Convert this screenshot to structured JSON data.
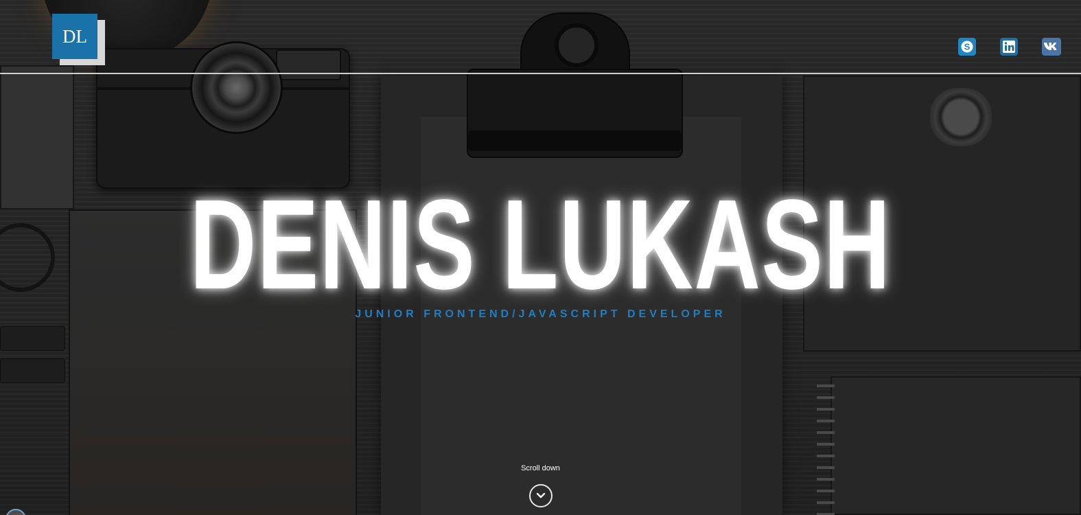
{
  "header": {
    "logo_text": "DL",
    "social": [
      {
        "name": "skype",
        "icon": "skype-icon",
        "color": "#1f86c3"
      },
      {
        "name": "linkedin",
        "icon": "linkedin-icon",
        "color": "#1f6fa3"
      },
      {
        "name": "vk",
        "icon": "vk-icon",
        "color": "#4a75a6"
      }
    ]
  },
  "hero": {
    "title": "DENIS LUKASH",
    "subtitle": "JUNIOR FRONTEND/JAVASCRIPT DEVELOPER",
    "scroll_label": "Scroll down"
  },
  "colors": {
    "accent": "#1a73a8",
    "subtitle": "#1f7fc0"
  }
}
